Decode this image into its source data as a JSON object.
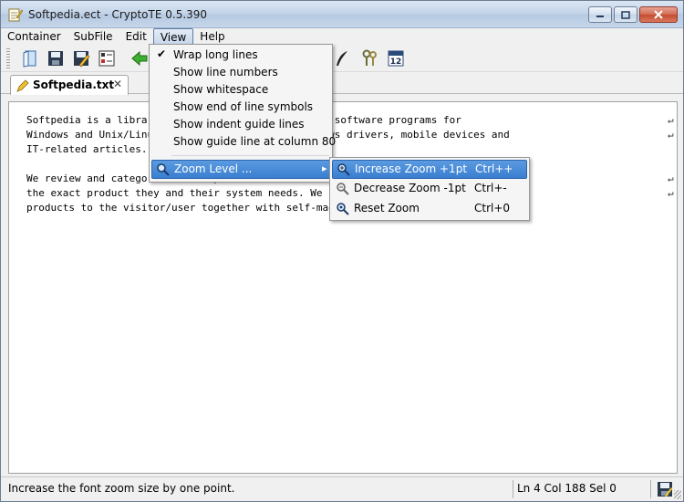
{
  "window": {
    "title": "Softpedia.ect - CryptoTE 0.5.390"
  },
  "menubar": [
    "Container",
    "SubFile",
    "Edit",
    "View",
    "Help"
  ],
  "toolbar": {
    "icons": [
      "open-book-icon",
      "save-icon",
      "save-as-icon",
      "properties-icon",
      "back-arrow-icon",
      "feather-icon",
      "keys-icon",
      "calendar-icon"
    ],
    "calendar_day": "12"
  },
  "tab": {
    "label": "Softpedia.txt",
    "close": "✕"
  },
  "editor": {
    "lines": [
      "Softpedia is a library of freeware and free-to-try software programs for",
      "Windows and Unix/Linux, games, Mac software, Windows drivers, mobile devices and",
      "IT-related articles.",
      "",
      "We review and categorize these products in order to allow the visitor/user to find",
      "the exact product they and their system needs. We strive to deliver only the best",
      "products to the visitor/user together with self-made evaluation and review notes."
    ],
    "wrap_symbol": "↵"
  },
  "view_menu": {
    "items": [
      {
        "label": "Wrap long lines",
        "checked": true
      },
      {
        "label": "Show line numbers",
        "checked": false
      },
      {
        "label": "Show whitespace",
        "checked": false
      },
      {
        "label": "Show end of line symbols",
        "checked": false
      },
      {
        "label": "Show indent guide lines",
        "checked": false
      },
      {
        "label": "Show guide line at column 80",
        "checked": false
      }
    ],
    "zoom": {
      "label": "Zoom Level ...",
      "arrow": "▸"
    }
  },
  "zoom_menu": [
    {
      "label": "Increase Zoom +1pt",
      "shortcut": "Ctrl++"
    },
    {
      "label": "Decrease Zoom -1pt",
      "shortcut": "Ctrl+-"
    },
    {
      "label": "Reset Zoom",
      "shortcut": "Ctrl+0"
    }
  ],
  "statusbar": {
    "message": "Increase the font zoom size by one point.",
    "position": "Ln 4 Col 188 Sel 0"
  },
  "check_mark": "✔",
  "colors": {
    "highlight": "#3a7fd0",
    "titlebar": "#c2d3e8"
  }
}
